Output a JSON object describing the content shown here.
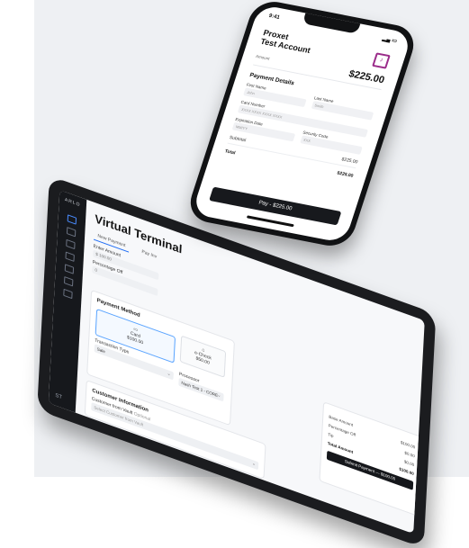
{
  "tablet": {
    "brand": "ARLO",
    "title": "Virtual Terminal",
    "tabs": [
      "New Payment",
      "Pay Inv"
    ],
    "fields": {
      "enter_amount_label": "Enter Amount",
      "enter_amount_value": "$ 100.00",
      "percentage_label": "Percentage Off",
      "percentage_value": "0"
    },
    "payment_method": {
      "title": "Payment Method",
      "card_label": "Card",
      "card_amount": "$100.00",
      "echeck_label": "e-Check",
      "echeck_amount": "$50.00",
      "transaction_type_label": "Transaction Type",
      "transaction_type_value": "Sale",
      "processor_label": "Processor",
      "processor_value": "Nash Test 1 - CORE"
    },
    "customer": {
      "title": "Customer Information",
      "vault_label": "Customer from Vault",
      "vault_optional": "Optional",
      "vault_placeholder": "Select Customer from Vault"
    },
    "summary": {
      "rows": [
        {
          "label": "Base Amount",
          "value": "$100.00"
        },
        {
          "label": "Percentage Off",
          "value": "$0.00"
        },
        {
          "label": "Tip",
          "value": "$0.00"
        },
        {
          "label": "Total Amount",
          "value": "$100.00"
        }
      ],
      "submit_label": "Submit Payment — $100.00"
    },
    "sidebar_footer": "ST"
  },
  "phone": {
    "time": "9:41",
    "title_line1": "Proxet",
    "title_line2": "Test Account",
    "amount_label": "Amount",
    "amount_value": "$225.00",
    "details_title": "Payment Details",
    "first_name_label": "First Name",
    "first_name_placeholder": "John",
    "last_name_label": "Last Name",
    "last_name_placeholder": "Smith",
    "card_number_label": "Card Number",
    "card_number_placeholder": "XXXX XXXX XXXX XXXX",
    "expiration_label": "Expiration Date",
    "expiration_placeholder": "MM/YY",
    "security_label": "Security Code",
    "security_placeholder": "XXX",
    "subtotal_label": "Subtotal",
    "subtotal_value": "$225.00",
    "total_label": "Total",
    "total_value": "$225.00",
    "pay_button": "Pay - $225.00"
  },
  "colors": {
    "accent": "#1d6cf5",
    "logo": "#9b2c8a",
    "dark": "#15171b"
  }
}
